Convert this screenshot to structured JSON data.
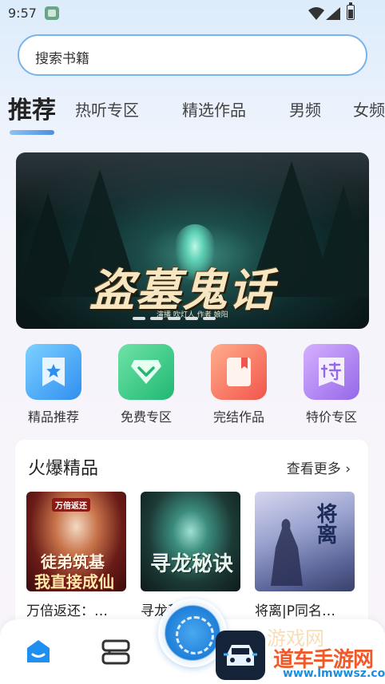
{
  "status_bar": {
    "time": "9:57",
    "app_icon": "gallery-icon",
    "icons": [
      "wifi-icon",
      "signal-icon",
      "battery-icon"
    ]
  },
  "search": {
    "placeholder": "搜索书籍"
  },
  "tabs": [
    {
      "label": "推荐",
      "active": true
    },
    {
      "label": "热听专区",
      "active": false
    },
    {
      "label": "精选作品",
      "active": false
    },
    {
      "label": "男频",
      "active": false
    },
    {
      "label": "女频",
      "active": false
    }
  ],
  "banner": {
    "title": "盗墓鬼话",
    "credit": "演播 吹灯人 作者 娘阳",
    "slide_count": 5,
    "active_slide": 1
  },
  "shortcuts": [
    {
      "label": "精品推荐",
      "icon": "star-bookmark-icon",
      "color": "#3a9cf3"
    },
    {
      "label": "免费专区",
      "icon": "diamond-chevron-icon",
      "color": "#25bb78"
    },
    {
      "label": "完结作品",
      "icon": "book-bookmark-icon",
      "color": "#f26455"
    },
    {
      "label": "特价专区",
      "icon": "special-price-icon",
      "color": "#9b70ea"
    }
  ],
  "hot_section": {
    "title": "火爆精品",
    "more_label": "查看更多",
    "books": [
      {
        "title": "万倍返还：…",
        "cover_badge": "万倍返还",
        "cover_line1": "徒弟筑基",
        "cover_line2": "我直接成仙"
      },
      {
        "title": "寻龙秘诀…",
        "cover_line1": "寻龙秘诀"
      },
      {
        "title": "将离|P同名…",
        "cover_line1": "将离"
      }
    ]
  },
  "bottom_nav": {
    "items": [
      "home-icon",
      "bookshelf-icon",
      "player-disc-icon"
    ],
    "watermark_main": "道车手游网",
    "watermark_sub": "www.lmwwsz.com",
    "watermark_faint": "游戏网"
  },
  "colors": {
    "accent": "#4c8fdf",
    "search_border": "#78b3e9",
    "watermark_orange": "#f05a2a",
    "watermark_blue": "#1a8ee0"
  }
}
